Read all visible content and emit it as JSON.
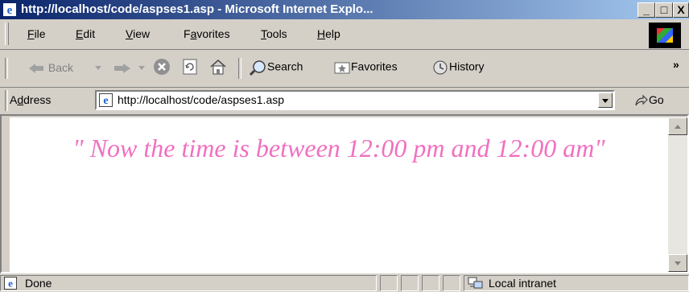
{
  "window": {
    "title": "http://localhost/code/aspses1.asp - Microsoft Internet Explo...",
    "minimize": "_",
    "maximize": "□",
    "close": "X"
  },
  "menu": {
    "file": {
      "accel": "F",
      "rest": "ile"
    },
    "edit": {
      "accel": "E",
      "rest": "dit"
    },
    "view": {
      "accel": "V",
      "rest": "iew"
    },
    "favorites": {
      "pre": "F",
      "accel": "a",
      "rest": "vorites"
    },
    "tools": {
      "accel": "T",
      "rest": "ools"
    },
    "help": {
      "accel": "H",
      "rest": "elp"
    }
  },
  "toolbar": {
    "back": "Back",
    "search": "Search",
    "favorites": "Favorites",
    "history": "History",
    "more": "»"
  },
  "address": {
    "label_pre": "A",
    "label_accel": "d",
    "label_rest": "dress",
    "value": "http://localhost/code/aspses1.asp",
    "go": "Go"
  },
  "page": {
    "message": "\" Now the time is between 12:00 pm and 12:00 am\"",
    "text_color": "#f070c0"
  },
  "status": {
    "text": "Done",
    "zone": "Local intranet"
  }
}
